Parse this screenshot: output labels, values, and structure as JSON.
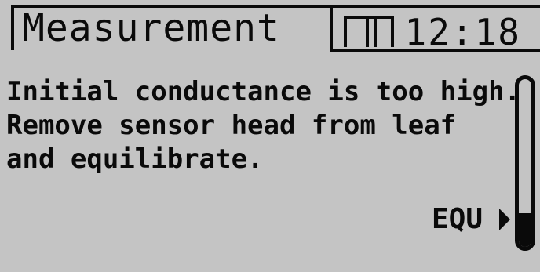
{
  "header": {
    "title": "Measurement",
    "time": "12:18"
  },
  "icons": {
    "battery": "battery-icon",
    "equ_arrow": "play-triangle-icon"
  },
  "message": {
    "lines": [
      "Initial conductance is too high.",
      "Remove sensor head from leaf",
      "and equilibrate."
    ]
  },
  "gauge": {
    "label": "EQU",
    "level_fraction": 0.2
  },
  "colors": {
    "screen_background": "#c4c4c4",
    "foreground": "#0a0a0a"
  }
}
